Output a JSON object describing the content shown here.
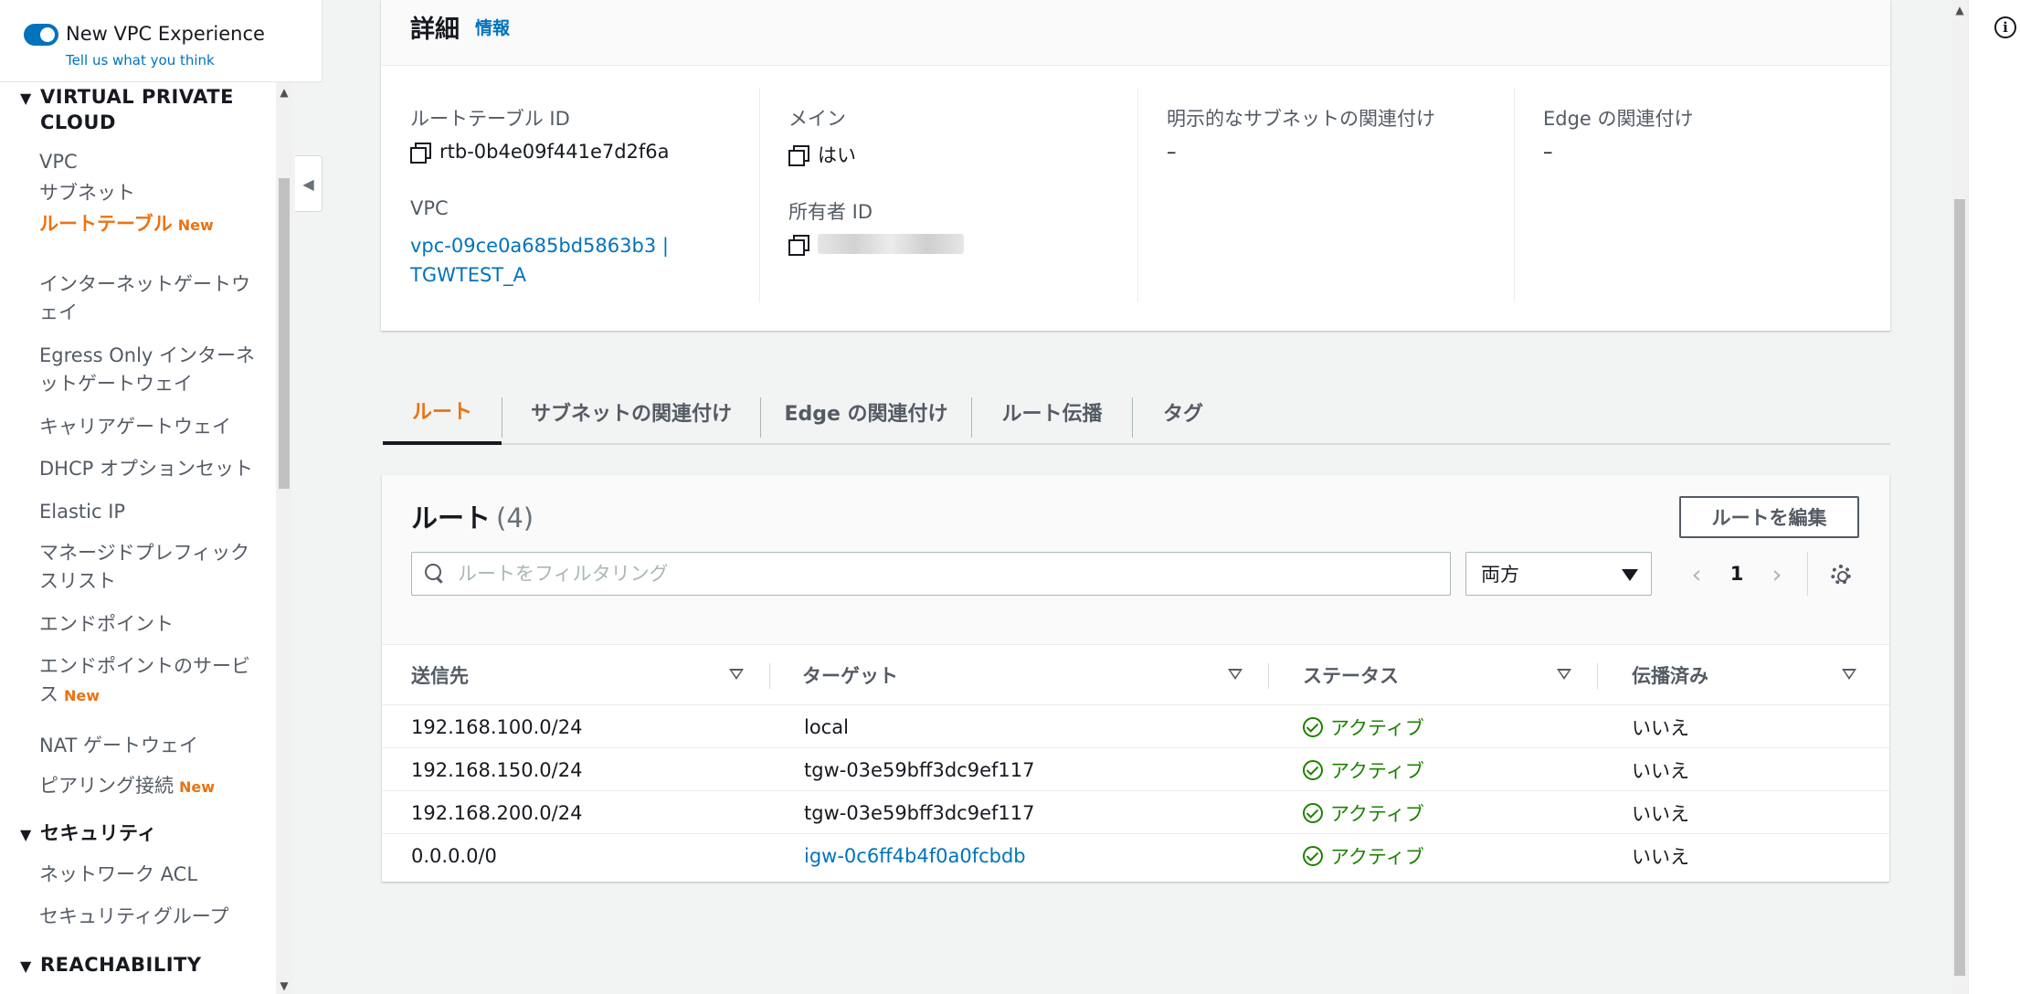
{
  "experience": {
    "title": "New VPC Experience",
    "subtitle": "Tell us what you think"
  },
  "nav": {
    "section_vpc": "VIRTUAL PRIVATE CLOUD",
    "items": [
      {
        "label": "VPC"
      },
      {
        "label": "サブネット"
      },
      {
        "label": "ルートテーブル",
        "badge": "New"
      },
      {
        "label": "インターネットゲートウェイ"
      },
      {
        "label": "Egress Only インターネットゲートウェイ"
      },
      {
        "label": "キャリアゲートウェイ"
      },
      {
        "label": "DHCP オプションセット"
      },
      {
        "label": "Elastic IP"
      },
      {
        "label": "マネージドプレフィックスリスト"
      },
      {
        "label": "エンドポイント"
      },
      {
        "label": "エンドポイントのサービス",
        "badge": "New"
      },
      {
        "label": "NAT ゲートウェイ"
      },
      {
        "label": "ピアリング接続",
        "badge": "New"
      }
    ],
    "section_security": "セキュリティ",
    "security_items": [
      {
        "label": "ネットワーク ACL"
      },
      {
        "label": "セキュリティグループ"
      }
    ],
    "section_reachability": "REACHABILITY"
  },
  "details": {
    "title": "詳細",
    "info": "情報",
    "route_table_id_label": "ルートテーブル ID",
    "route_table_id": "rtb-0b4e09f441e7d2f6a",
    "vpc_label": "VPC",
    "vpc_line1": "vpc-09ce0a685bd5863b3 |",
    "vpc_line2": "TGWTEST_A",
    "main_label": "メイン",
    "main_value": "はい",
    "owner_label": "所有者 ID",
    "explicit_label": "明示的なサブネットの関連付け",
    "explicit_value": "–",
    "edge_label": "Edge の関連付け",
    "edge_value": "–"
  },
  "tabs": [
    {
      "label": "ルート"
    },
    {
      "label": "サブネットの関連付け"
    },
    {
      "label": "Edge の関連付け"
    },
    {
      "label": "ルート伝播"
    },
    {
      "label": "タグ"
    }
  ],
  "routes": {
    "title": "ルート",
    "count": "(4)",
    "edit_label": "ルートを編集",
    "filter_placeholder": "ルートをフィルタリング",
    "scope_value": "両方",
    "page": "1",
    "prev": "‹",
    "next": "›",
    "columns": [
      "送信先",
      "ターゲット",
      "ステータス",
      "伝播済み"
    ],
    "rows": [
      {
        "destination": "192.168.100.0/24",
        "target": "local",
        "status": "アクティブ",
        "propagated": "いいえ"
      },
      {
        "destination": "192.168.150.0/24",
        "target": "tgw-03e59bff3dc9ef117",
        "status": "アクティブ",
        "propagated": "いいえ"
      },
      {
        "destination": "192.168.200.0/24",
        "target": "tgw-03e59bff3dc9ef117",
        "status": "アクティブ",
        "propagated": "いいえ"
      },
      {
        "destination": "0.0.0.0/0",
        "target": "igw-0c6ff4b4f0a0fcbdb",
        "status": "アクティブ",
        "propagated": "いいえ"
      }
    ]
  },
  "info_icon_glyph": "i",
  "colors": {
    "accent_orange": "#ec7211",
    "link_blue": "#0073bb",
    "status_green": "#1d8102"
  }
}
